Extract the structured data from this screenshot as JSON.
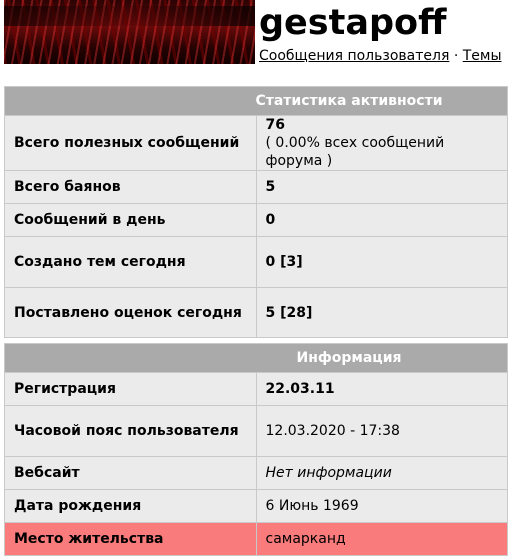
{
  "header": {
    "username": "gestapoff",
    "links": [
      "Сообщения пользователя",
      "Темы"
    ],
    "separator": "·"
  },
  "activity": {
    "title": "Статистика активности",
    "rows": [
      {
        "label": "Всего полезных сообщений",
        "value": "76",
        "sub": "( 0.00% всех сообщений форума )"
      },
      {
        "label": "Всего баянов",
        "value": "5"
      },
      {
        "label": "Сообщений в день",
        "value": "0"
      },
      {
        "label": "Создано тем сегодня",
        "value": "0 [3]"
      },
      {
        "label": "Поставлено оценок сегодня",
        "value": "5 [28]"
      }
    ]
  },
  "info": {
    "title": "Информация",
    "rows": [
      {
        "label": "Регистрация",
        "value": "22.03.11"
      },
      {
        "label": "Часовой пояс пользователя",
        "value": "12.03.2020 - 17:38"
      },
      {
        "label": "Вебсайт",
        "value": "Нет информации"
      },
      {
        "label": "Дата рождения",
        "value": "6 Июнь 1969"
      },
      {
        "label": "Место жительства",
        "value": "самарканд"
      }
    ]
  },
  "colors": {
    "header_bg": "#aaaaaa",
    "row_bg": "#ebebeb",
    "highlight": "#f97b7b"
  }
}
